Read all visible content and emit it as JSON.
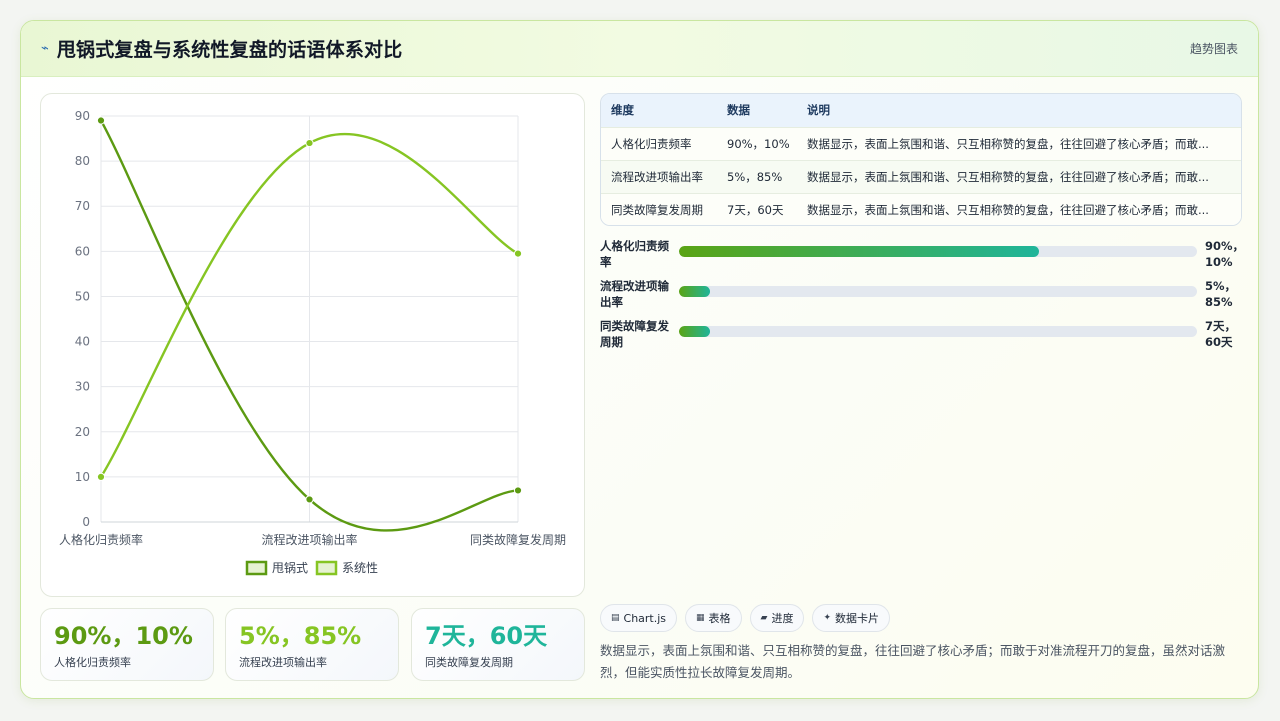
{
  "header": {
    "icon": "spark-icon",
    "title": "甩锅式复盘与系统性复盘的话语体系对比",
    "link": "趋势图表"
  },
  "chart_data": {
    "type": "line",
    "categories": [
      "人格化归责频率",
      "流程改进项输出率",
      "同类故障复发周期"
    ],
    "series": [
      {
        "name": "甩锅式",
        "values": [
          89,
          5,
          7
        ],
        "color": "#5c9a12"
      },
      {
        "name": "系统性",
        "values": [
          10,
          84,
          59.5
        ],
        "color": "#86c523"
      }
    ],
    "ylim": [
      0,
      90
    ],
    "yticks": [
      0,
      10,
      20,
      30,
      40,
      50,
      60,
      70,
      80,
      90
    ],
    "grid": true,
    "legend": "bottom",
    "curve": "smooth"
  },
  "stats": [
    {
      "value": "90%，10%",
      "label": "人格化归责频率",
      "color": "#5c9a12"
    },
    {
      "value": "5%，85%",
      "label": "流程改进项输出率",
      "color": "#86c523"
    },
    {
      "value": "7天，60天",
      "label": "同类故障复发周期",
      "color": "#1fb59a"
    }
  ],
  "table": {
    "headers": [
      "维度",
      "数据",
      "说明"
    ],
    "rows": [
      [
        "人格化归责频率",
        "90%，10%",
        "数据显示，表面上氛围和谐、只互相称赞的复盘，往往回避了核心矛盾；而敢..."
      ],
      [
        "流程改进项输出率",
        "5%，85%",
        "数据显示，表面上氛围和谐、只互相称赞的复盘，往往回避了核心矛盾；而敢..."
      ],
      [
        "同类故障复发周期",
        "7天，60天",
        "数据显示，表面上氛围和谐、只互相称赞的复盘，往往回避了核心矛盾；而敢..."
      ]
    ]
  },
  "bars": [
    {
      "label": "人格化归责频率",
      "value_text": "90%，10%",
      "fill": 0.695
    },
    {
      "label": "流程改进项输出率",
      "value_text": "5%，85%",
      "fill": 0.06
    },
    {
      "label": "同类故障复发周期",
      "value_text": "7天，60天",
      "fill": 0.06
    }
  ],
  "chips": [
    {
      "icon": "chart-icon",
      "glyph": "▤",
      "label": "Chart.js"
    },
    {
      "icon": "table-icon",
      "glyph": "▦",
      "label": "表格"
    },
    {
      "icon": "progress-icon",
      "glyph": "▰",
      "label": "进度"
    },
    {
      "icon": "card-icon",
      "glyph": "✦",
      "label": "数据卡片"
    }
  ],
  "summary": "数据显示，表面上氛围和谐、只互相称赞的复盘，往往回避了核心矛盾；而敢于对准流程开刀的复盘，虽然对话激烈，但能实质性拉长故障复发周期。"
}
